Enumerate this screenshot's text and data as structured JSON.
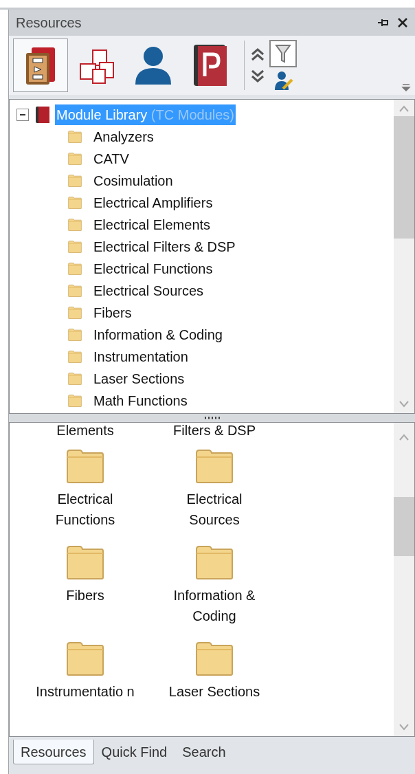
{
  "panel": {
    "title": "Resources"
  },
  "toolbar": [
    {
      "kind": "library",
      "selected": true
    },
    {
      "kind": "symbols",
      "selected": false
    },
    {
      "kind": "user",
      "selected": false
    },
    {
      "kind": "project",
      "selected": false
    }
  ],
  "toolbar_right": {
    "filter_selected": true
  },
  "tree": {
    "root": {
      "label": "Module Library",
      "sublabel": "(TC Modules)",
      "selected": true,
      "expanded": true,
      "children": [
        {
          "label": "Analyzers"
        },
        {
          "label": "CATV"
        },
        {
          "label": "Cosimulation"
        },
        {
          "label": "Electrical Amplifiers"
        },
        {
          "label": "Electrical Elements"
        },
        {
          "label": "Electrical Filters & DSP"
        },
        {
          "label": "Electrical Functions"
        },
        {
          "label": "Electrical Sources"
        },
        {
          "label": "Fibers"
        },
        {
          "label": "Information & Coding"
        },
        {
          "label": "Instrumentation"
        },
        {
          "label": "Laser Sections"
        },
        {
          "label": "Math Functions"
        }
      ]
    }
  },
  "icon_view": {
    "cut_labels": [
      "Elements",
      "Filters & DSP"
    ],
    "items": [
      {
        "label": "Electrical Functions"
      },
      {
        "label": "Electrical Sources"
      },
      {
        "label": "Fibers"
      },
      {
        "label": "Information & Coding"
      },
      {
        "label": "Instrumentatio n"
      },
      {
        "label": "Laser Sections"
      }
    ]
  },
  "tabs": [
    {
      "label": "Resources",
      "selected": true
    },
    {
      "label": "Quick Find",
      "selected": false
    },
    {
      "label": "Search",
      "selected": false
    }
  ]
}
